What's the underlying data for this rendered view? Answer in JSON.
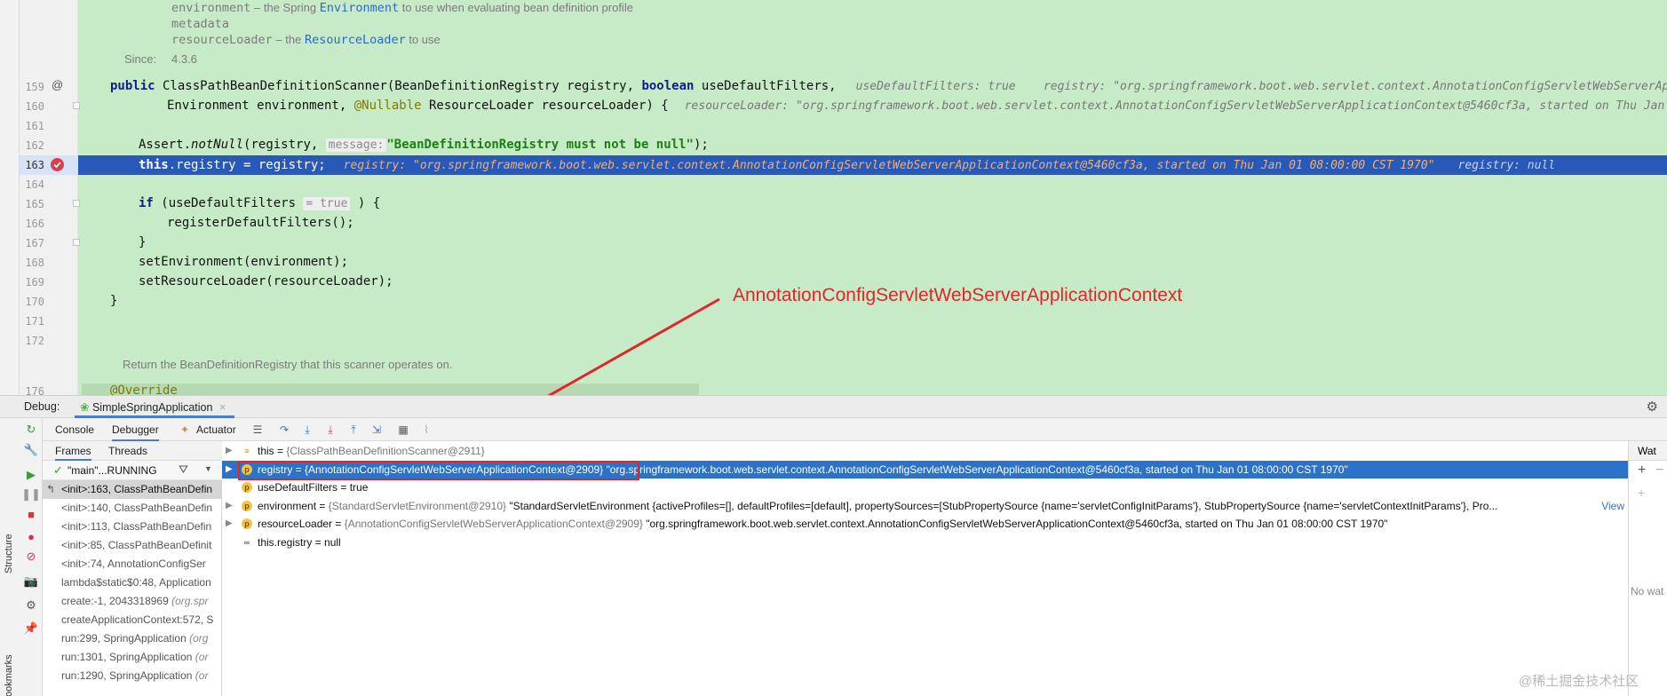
{
  "colors": {
    "editor_bg": "#c8ebc7",
    "exec_line": "#2858b8",
    "selection": "#2c72c9",
    "annotation_red": "#e0262b",
    "keyword": "#0a1f8a",
    "string": "#1b7f13"
  },
  "javadoc": {
    "env_name": "environment",
    "env_text_1": " – the Spring ",
    "env_link": "Environment",
    "env_text_2": " to use when evaluating bean definition profile",
    "env_text_3": "metadata",
    "rl_name": "resourceLoader",
    "rl_text_1": " – the ",
    "rl_link": "ResourceLoader",
    "rl_text_2": " to use",
    "since_label": "Since:",
    "since_value": "4.3.6",
    "return_doc": "Return the BeanDefinitionRegistry that this scanner operates on."
  },
  "code": {
    "l159": {
      "num": "159",
      "kw1": "public",
      "t1": " ClassPathBeanDefinitionScanner(BeanDefinitionRegistry registry, ",
      "kw2": "boolean",
      "t2": " useDefaultFilters,",
      "inline": "useDefaultFilters: true    registry: \"org.springframework.boot.web.servlet.context.AnnotationConfigServletWebServerAppli"
    },
    "l160": {
      "num": "160",
      "t1": "Environment environment, ",
      "ann": "@Nullable",
      "t2": " ResourceLoader resourceLoader) {",
      "inline": "resourceLoader: \"org.springframework.boot.web.servlet.context.AnnotationConfigServletWebServerApplicationContext@5460cf3a, started on Thu Jan"
    },
    "l161": {
      "num": "161"
    },
    "l162": {
      "num": "162",
      "t1": "Assert.",
      "t_italic": "notNull",
      "t2": "(registry, ",
      "hint": "message:",
      "str": "\"BeanDefinitionRegistry must not be null\"",
      "t3": ");"
    },
    "l163": {
      "num": "163",
      "kw": "this",
      "t1": ".registry = registry;",
      "inline1": "registry: \"org.springframework.boot.web.servlet.context.AnnotationConfigServletWebServerApplicationContext@5460cf3a, started on Thu Jan 01 08:00:00 CST 1970\"",
      "inline2": "registry: null"
    },
    "l164": {
      "num": "164"
    },
    "l165": {
      "num": "165",
      "kw": "if",
      "t1": " (useDefaultFilters ",
      "hint": "= true",
      "t2": " ) {"
    },
    "l166": {
      "num": "166",
      "t1": "registerDefaultFilters();"
    },
    "l167": {
      "num": "167",
      "t1": "}"
    },
    "l168": {
      "num": "168",
      "t1": "setEnvironment(environment);"
    },
    "l169": {
      "num": "169",
      "t1": "setResourceLoader(resourceLoader);"
    },
    "l170": {
      "num": "170",
      "t1": "}"
    },
    "l171": {
      "num": "171"
    },
    "l172": {
      "num": "172"
    },
    "l176": {
      "num": "176",
      "ann": "@Override"
    }
  },
  "annotation_label": "AnnotationConfigServletWebServerApplicationContext",
  "debug": {
    "title": "Debug:",
    "run_config": "SimpleSpringApplication",
    "tabs": {
      "console": "Console",
      "debugger": "Debugger",
      "actuator": "Actuator"
    },
    "subtabs": {
      "frames": "Frames",
      "threads": "Threads"
    },
    "thread": "\"main\"...RUNNING",
    "side_labels": {
      "structure": "Structure",
      "bookmarks": "ookmarks"
    },
    "frames": [
      {
        "text": "<init>:163, ClassPathBeanDefin"
      },
      {
        "text": "<init>:140, ClassPathBeanDefin"
      },
      {
        "text": "<init>:113, ClassPathBeanDefin"
      },
      {
        "text": "<init>:85, ClassPathBeanDefinit"
      },
      {
        "text": "<init>:74, AnnotationConfigSer"
      },
      {
        "text": "lambda$static$0:48, Application"
      },
      {
        "text": "create:-1, 2043318969 ",
        "italic": "(org.spr"
      },
      {
        "text": "createApplicationContext:572, S"
      },
      {
        "text": "run:299, SpringApplication ",
        "italic": "(org"
      },
      {
        "text": "run:1301, SpringApplication ",
        "italic": "(or"
      },
      {
        "text": "run:1290, SpringApplication ",
        "italic": "(or"
      }
    ],
    "variables": [
      {
        "name": "this = ",
        "grey": "{ClassPathBeanDefinitionScanner@2911}",
        "rest": ""
      },
      {
        "name": "registry = ",
        "grey": "{AnnotationConfigServletWebServerApplicationContext@2909}",
        "rest": " \"org.springframework.boot.web.servlet.context.AnnotationConfigServletWebServerApplicationContext@5460cf3a, started on Thu Jan 01 08:00:00 CST 1970\""
      },
      {
        "name": "useDefaultFilters = true",
        "grey": "",
        "rest": ""
      },
      {
        "name": "environment = ",
        "grey": "{StandardServletEnvironment@2910}",
        "rest": " \"StandardServletEnvironment {activeProfiles=[], defaultProfiles=[default], propertySources=[StubPropertySource {name='servletConfigInitParams'}, StubPropertySource {name='servletContextInitParams'}, Pro...",
        "link": "View"
      },
      {
        "name": "resourceLoader = ",
        "grey": "{AnnotationConfigServletWebServerApplicationContext@2909}",
        "rest": " \"org.springframework.boot.web.servlet.context.AnnotationConfigServletWebServerApplicationContext@5460cf3a, started on Thu Jan 01 08:00:00 CST 1970\""
      },
      {
        "name": "this.registry = null",
        "grey": "",
        "rest": ""
      }
    ],
    "watches": {
      "tab": "Wat",
      "empty": "No wat"
    }
  },
  "watermark": "@稀土掘金技术社区"
}
